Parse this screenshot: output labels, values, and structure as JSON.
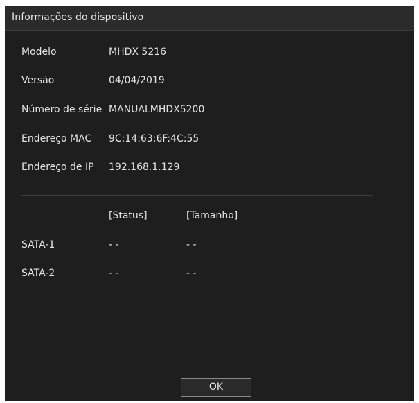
{
  "dialog": {
    "title": "Informações do dispositivo"
  },
  "info": {
    "rows": [
      {
        "label": "Modelo",
        "value": "MHDX 5216"
      },
      {
        "label": "Versão",
        "value": "04/04/2019"
      },
      {
        "label": "Número de série",
        "value": "MANUALMHDX5200"
      },
      {
        "label": "Endereço MAC",
        "value": "9C:14:63:6F:4C:55"
      },
      {
        "label": "Endereço de IP",
        "value": "192.168.1.129"
      }
    ]
  },
  "disks": {
    "headers": {
      "status": "[Status]",
      "size": "[Tamanho]"
    },
    "rows": [
      {
        "label": "SATA-1",
        "status": "- -",
        "size": "- -"
      },
      {
        "label": "SATA-2",
        "status": "- -",
        "size": "- -"
      }
    ]
  },
  "buttons": {
    "ok_label": "OK"
  }
}
